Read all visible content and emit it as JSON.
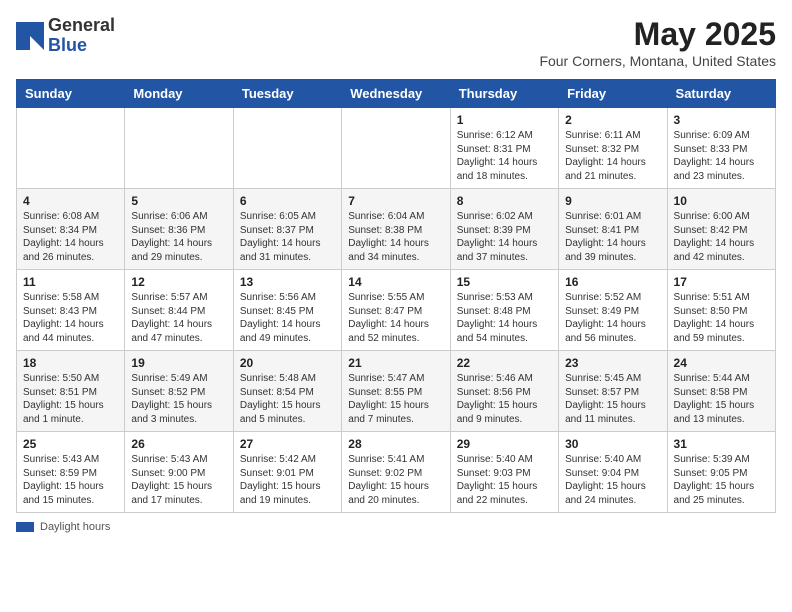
{
  "header": {
    "logo_general": "General",
    "logo_blue": "Blue",
    "month_title": "May 2025",
    "location": "Four Corners, Montana, United States"
  },
  "days_of_week": [
    "Sunday",
    "Monday",
    "Tuesday",
    "Wednesday",
    "Thursday",
    "Friday",
    "Saturday"
  ],
  "weeks": [
    [
      {
        "day": "",
        "info": ""
      },
      {
        "day": "",
        "info": ""
      },
      {
        "day": "",
        "info": ""
      },
      {
        "day": "",
        "info": ""
      },
      {
        "day": "1",
        "info": "Sunrise: 6:12 AM\nSunset: 8:31 PM\nDaylight: 14 hours and 18 minutes."
      },
      {
        "day": "2",
        "info": "Sunrise: 6:11 AM\nSunset: 8:32 PM\nDaylight: 14 hours and 21 minutes."
      },
      {
        "day": "3",
        "info": "Sunrise: 6:09 AM\nSunset: 8:33 PM\nDaylight: 14 hours and 23 minutes."
      }
    ],
    [
      {
        "day": "4",
        "info": "Sunrise: 6:08 AM\nSunset: 8:34 PM\nDaylight: 14 hours and 26 minutes."
      },
      {
        "day": "5",
        "info": "Sunrise: 6:06 AM\nSunset: 8:36 PM\nDaylight: 14 hours and 29 minutes."
      },
      {
        "day": "6",
        "info": "Sunrise: 6:05 AM\nSunset: 8:37 PM\nDaylight: 14 hours and 31 minutes."
      },
      {
        "day": "7",
        "info": "Sunrise: 6:04 AM\nSunset: 8:38 PM\nDaylight: 14 hours and 34 minutes."
      },
      {
        "day": "8",
        "info": "Sunrise: 6:02 AM\nSunset: 8:39 PM\nDaylight: 14 hours and 37 minutes."
      },
      {
        "day": "9",
        "info": "Sunrise: 6:01 AM\nSunset: 8:41 PM\nDaylight: 14 hours and 39 minutes."
      },
      {
        "day": "10",
        "info": "Sunrise: 6:00 AM\nSunset: 8:42 PM\nDaylight: 14 hours and 42 minutes."
      }
    ],
    [
      {
        "day": "11",
        "info": "Sunrise: 5:58 AM\nSunset: 8:43 PM\nDaylight: 14 hours and 44 minutes."
      },
      {
        "day": "12",
        "info": "Sunrise: 5:57 AM\nSunset: 8:44 PM\nDaylight: 14 hours and 47 minutes."
      },
      {
        "day": "13",
        "info": "Sunrise: 5:56 AM\nSunset: 8:45 PM\nDaylight: 14 hours and 49 minutes."
      },
      {
        "day": "14",
        "info": "Sunrise: 5:55 AM\nSunset: 8:47 PM\nDaylight: 14 hours and 52 minutes."
      },
      {
        "day": "15",
        "info": "Sunrise: 5:53 AM\nSunset: 8:48 PM\nDaylight: 14 hours and 54 minutes."
      },
      {
        "day": "16",
        "info": "Sunrise: 5:52 AM\nSunset: 8:49 PM\nDaylight: 14 hours and 56 minutes."
      },
      {
        "day": "17",
        "info": "Sunrise: 5:51 AM\nSunset: 8:50 PM\nDaylight: 14 hours and 59 minutes."
      }
    ],
    [
      {
        "day": "18",
        "info": "Sunrise: 5:50 AM\nSunset: 8:51 PM\nDaylight: 15 hours and 1 minute."
      },
      {
        "day": "19",
        "info": "Sunrise: 5:49 AM\nSunset: 8:52 PM\nDaylight: 15 hours and 3 minutes."
      },
      {
        "day": "20",
        "info": "Sunrise: 5:48 AM\nSunset: 8:54 PM\nDaylight: 15 hours and 5 minutes."
      },
      {
        "day": "21",
        "info": "Sunrise: 5:47 AM\nSunset: 8:55 PM\nDaylight: 15 hours and 7 minutes."
      },
      {
        "day": "22",
        "info": "Sunrise: 5:46 AM\nSunset: 8:56 PM\nDaylight: 15 hours and 9 minutes."
      },
      {
        "day": "23",
        "info": "Sunrise: 5:45 AM\nSunset: 8:57 PM\nDaylight: 15 hours and 11 minutes."
      },
      {
        "day": "24",
        "info": "Sunrise: 5:44 AM\nSunset: 8:58 PM\nDaylight: 15 hours and 13 minutes."
      }
    ],
    [
      {
        "day": "25",
        "info": "Sunrise: 5:43 AM\nSunset: 8:59 PM\nDaylight: 15 hours and 15 minutes."
      },
      {
        "day": "26",
        "info": "Sunrise: 5:43 AM\nSunset: 9:00 PM\nDaylight: 15 hours and 17 minutes."
      },
      {
        "day": "27",
        "info": "Sunrise: 5:42 AM\nSunset: 9:01 PM\nDaylight: 15 hours and 19 minutes."
      },
      {
        "day": "28",
        "info": "Sunrise: 5:41 AM\nSunset: 9:02 PM\nDaylight: 15 hours and 20 minutes."
      },
      {
        "day": "29",
        "info": "Sunrise: 5:40 AM\nSunset: 9:03 PM\nDaylight: 15 hours and 22 minutes."
      },
      {
        "day": "30",
        "info": "Sunrise: 5:40 AM\nSunset: 9:04 PM\nDaylight: 15 hours and 24 minutes."
      },
      {
        "day": "31",
        "info": "Sunrise: 5:39 AM\nSunset: 9:05 PM\nDaylight: 15 hours and 25 minutes."
      }
    ]
  ],
  "legend": {
    "label": "Daylight hours"
  }
}
